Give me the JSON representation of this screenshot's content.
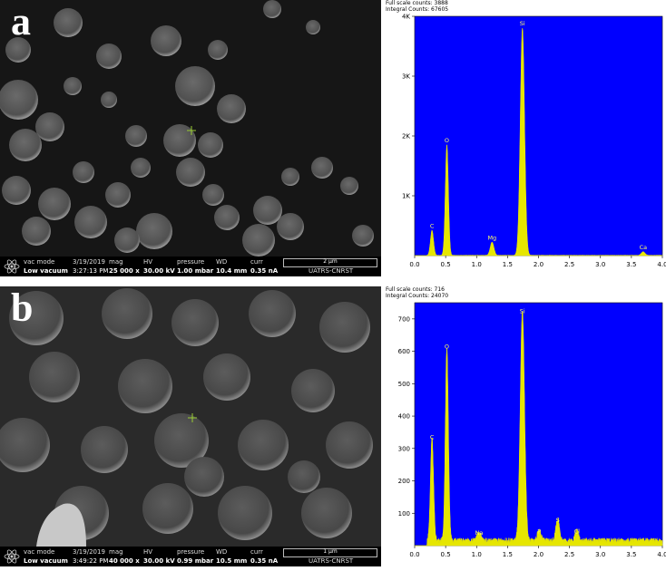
{
  "panels": [
    {
      "letter": "a",
      "sem": {
        "vac_mode_label": "vac mode",
        "vac_mode": "Low vacuum",
        "date": "3/19/2019",
        "time": "3:27:13 PM",
        "mag_label": "mag",
        "mag": "25 000 x",
        "hv_label": "HV",
        "hv": "30.00 kV",
        "pressure_label": "pressure",
        "pressure": "1.00 mbar",
        "wd_label": "WD",
        "wd": "10.4 mm",
        "curr_label": "curr",
        "curr": "0.35 nA",
        "scale": "2 µm",
        "lab": "UATRS-CNRST"
      },
      "eds": {
        "full_scale": "Full scale counts: 3888",
        "integral": "Integral Counts: 67605"
      },
      "chart_data": {
        "type": "line",
        "xlim": [
          0,
          4
        ],
        "ylim": [
          0,
          4000
        ],
        "xticks": [
          "0.0",
          "0.5",
          "1.0",
          "1.5",
          "2.0",
          "2.5",
          "3.0",
          "3.5",
          "4.0"
        ],
        "yticks": [
          "1K",
          "2K",
          "3K",
          "4K"
        ],
        "bg": "#0000ff",
        "fill": "#e6e600",
        "peaks": [
          {
            "x": 0.28,
            "y": 420,
            "w": 0.025
          },
          {
            "x": 0.52,
            "y": 1850,
            "w": 0.025
          },
          {
            "x": 1.25,
            "y": 220,
            "w": 0.03
          },
          {
            "x": 1.74,
            "y": 3800,
            "w": 0.035
          },
          {
            "x": 3.69,
            "y": 60,
            "w": 0.03
          }
        ],
        "noise": 5,
        "labels": [
          {
            "text": "C",
            "x": 0.28,
            "y": 420
          },
          {
            "text": "O",
            "x": 0.52,
            "y": 1850
          },
          {
            "text": "Mg",
            "x": 1.25,
            "y": 220
          },
          {
            "text": "Si",
            "x": 1.74,
            "y": 3800
          },
          {
            "text": "Ca",
            "x": 3.69,
            "y": 60
          }
        ]
      }
    },
    {
      "letter": "b",
      "sem": {
        "vac_mode_label": "vac mode",
        "vac_mode": "Low vacuum",
        "date": "3/19/2019",
        "time": "3:49:22 PM",
        "mag_label": "mag",
        "mag": "40 000 x",
        "hv_label": "HV",
        "hv": "30.00 kV",
        "pressure_label": "pressure",
        "pressure": "0.99 mbar",
        "wd_label": "WD",
        "wd": "10.5 mm",
        "curr_label": "curr",
        "curr": "0.35 nA",
        "scale": "1 µm",
        "lab": "UATRS-CNRST"
      },
      "eds": {
        "full_scale": "Full scale counts: 716",
        "integral": "Integral Counts: 24070"
      },
      "chart_data": {
        "type": "line",
        "xlim": [
          0,
          4
        ],
        "ylim": [
          0,
          750
        ],
        "xticks": [
          "0.0",
          "0.5",
          "1.0",
          "1.5",
          "2.0",
          "2.5",
          "3.0",
          "3.5",
          "4.0"
        ],
        "yticks": [
          "100",
          "200",
          "300",
          "400",
          "500",
          "600",
          "700"
        ],
        "bg": "#0000ff",
        "fill": "#e6e600",
        "peaks": [
          {
            "x": 0.28,
            "y": 320,
            "w": 0.025
          },
          {
            "x": 0.52,
            "y": 600,
            "w": 0.025
          },
          {
            "x": 1.04,
            "y": 25,
            "w": 0.03
          },
          {
            "x": 1.74,
            "y": 710,
            "w": 0.035
          },
          {
            "x": 2.01,
            "y": 30,
            "w": 0.03
          },
          {
            "x": 2.31,
            "y": 65,
            "w": 0.03
          },
          {
            "x": 2.62,
            "y": 30,
            "w": 0.03
          }
        ],
        "noise": 15,
        "labels": [
          {
            "text": "C",
            "x": 0.28,
            "y": 320
          },
          {
            "text": "O",
            "x": 0.52,
            "y": 600
          },
          {
            "text": "Na",
            "x": 1.04,
            "y": 25
          },
          {
            "text": "Si",
            "x": 1.74,
            "y": 710
          },
          {
            "text": "P",
            "x": 2.01,
            "y": 30
          },
          {
            "text": "S",
            "x": 2.31,
            "y": 65
          },
          {
            "text": "Cl",
            "x": 2.62,
            "y": 30
          }
        ]
      }
    }
  ]
}
